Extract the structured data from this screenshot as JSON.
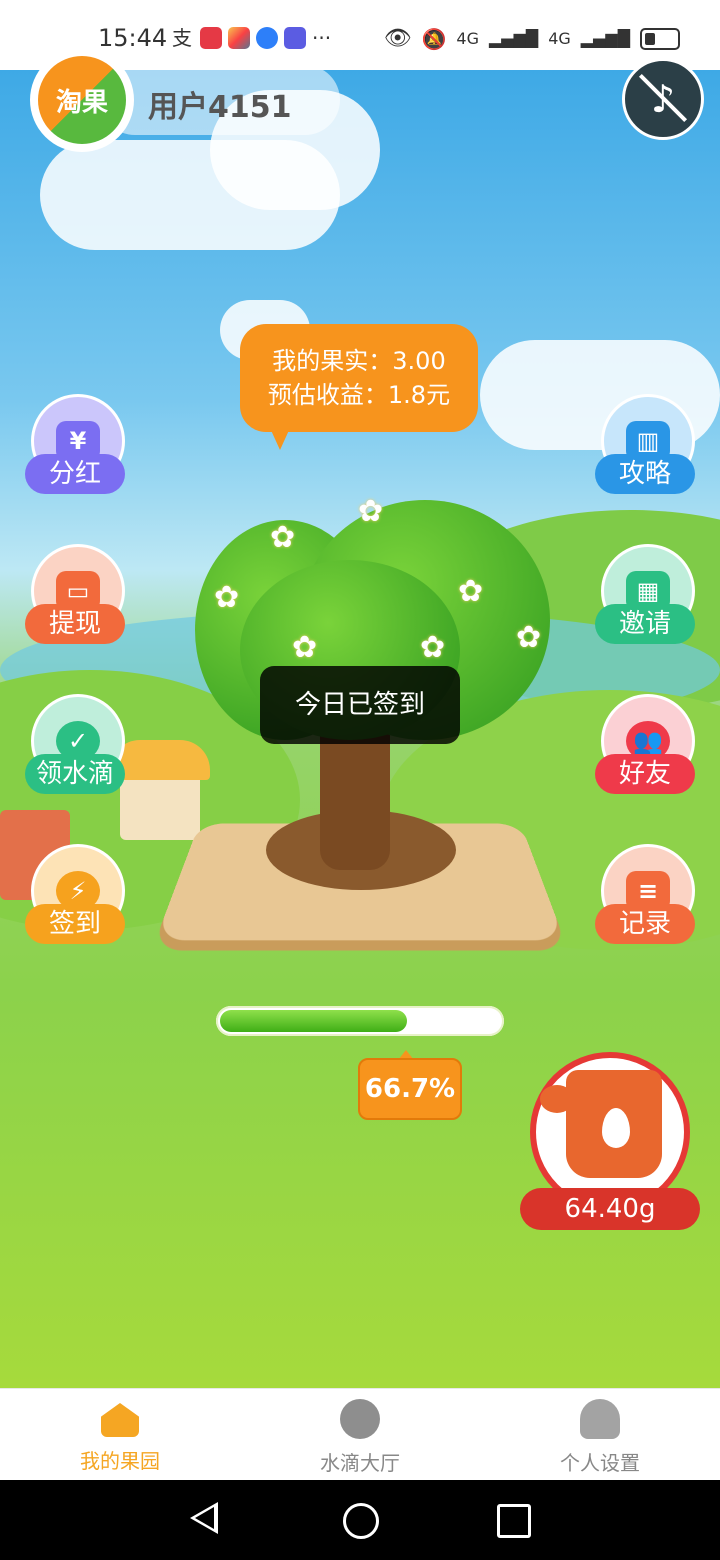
{
  "status_bar": {
    "time": "15:44",
    "network": "4G",
    "icons": [
      "alipay-icon",
      "book-app-icon",
      "colorful-app-icon",
      "blue-app-icon",
      "study-app-icon",
      "more-dots",
      "eye-icon",
      "mute-bell-icon",
      "signal-4g-icon",
      "signal-4g-icon",
      "battery-icon"
    ],
    "more": "···"
  },
  "profile": {
    "username": "用户4151",
    "logo_text": "淘果"
  },
  "bubble": {
    "fruit_label": "我的果实：3.00",
    "income_label": "预估收益：1.8元"
  },
  "left_buttons": [
    {
      "label": "分红",
      "icon": "dividend-house-icon",
      "color": "#7b6ef2"
    },
    {
      "label": "提现",
      "icon": "wallet-icon",
      "color": "#f26a3c"
    },
    {
      "label": "领水滴",
      "icon": "water-drop-check-icon",
      "color": "#2bbf84"
    },
    {
      "label": "签到",
      "icon": "alarm-clock-icon",
      "color": "#f6a21e"
    }
  ],
  "right_buttons": [
    {
      "label": "攻略",
      "icon": "open-book-icon",
      "color": "#2a96e6"
    },
    {
      "label": "邀请",
      "icon": "grid-invite-icon",
      "color": "#2bbf84"
    },
    {
      "label": "好友",
      "icon": "friends-icon",
      "color": "#ef3a4a"
    },
    {
      "label": "记录",
      "icon": "clipboard-icon",
      "color": "#f26a3c"
    }
  ],
  "toast": "今日已签到",
  "progress": {
    "value": 0.667,
    "label": "66.7%"
  },
  "watering_can": {
    "amount": "64.40g"
  },
  "bottom_nav": [
    {
      "label": "我的果园",
      "icon": "home-icon",
      "active": true
    },
    {
      "label": "水滴大厅",
      "icon": "compass-icon",
      "active": false
    },
    {
      "label": "个人设置",
      "icon": "person-icon",
      "active": false
    }
  ],
  "colors": {
    "accent": "#f5a623",
    "bubble": "#f7941d",
    "water_badge": "#d9342a"
  }
}
